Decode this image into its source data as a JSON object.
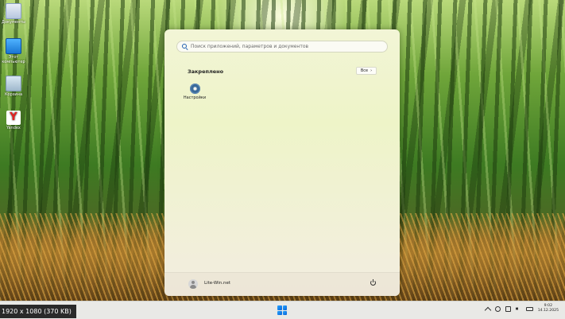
{
  "desktop": {
    "icons": [
      {
        "label": "Документы",
        "icon": "documents-icon"
      },
      {
        "label": "Этот компьютер",
        "icon": "this-pc-icon"
      },
      {
        "label": "Корзина",
        "icon": "recycle-bin-icon"
      },
      {
        "label": "Yandex",
        "icon": "yandex-browser-icon"
      }
    ]
  },
  "start_menu": {
    "search_placeholder": "Поиск приложений, параметров и документов",
    "pinned_title": "Закреплено",
    "all_button": "Все",
    "all_button_chevron": "›",
    "pinned_apps": [
      {
        "label": "Настройки",
        "icon": "settings-gear-icon"
      }
    ],
    "user_name": "Lite-Win.net",
    "power_icon": "power-icon"
  },
  "taskbar": {
    "start_icon": "windows-logo-icon",
    "tray_chevron": "^",
    "clock_time": "9:02",
    "clock_date": "14.12.2025"
  },
  "caption": "1920 x 1080 (370 KB)",
  "colors": {
    "accent": "#0a64d6",
    "search_icon": "#1f5fb0"
  }
}
